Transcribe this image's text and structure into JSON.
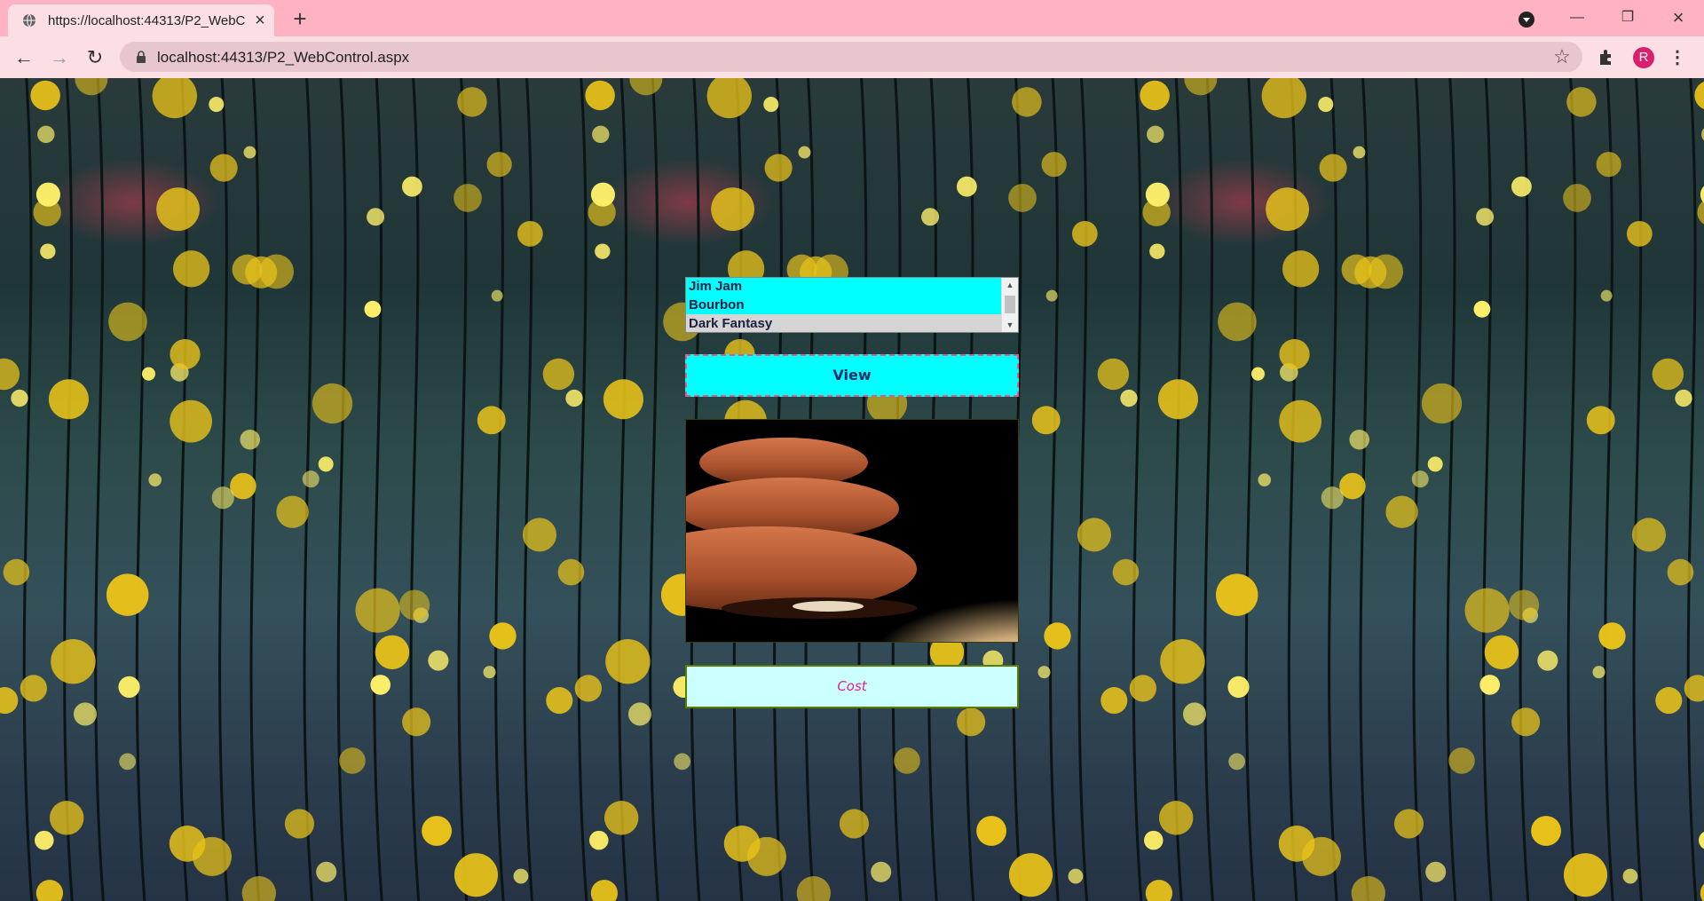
{
  "browser": {
    "tab_title": "https://localhost:44313/P2_WebC",
    "url": "localhost:44313/P2_WebControl.aspx",
    "profile_initial": "R",
    "accent_color": "#ffb2c1"
  },
  "page": {
    "biscuits": {
      "options": [
        "Jim Jam",
        "Bourbon",
        "Dark Fantasy"
      ],
      "selected": "Dark Fantasy"
    },
    "view_button_label": "View",
    "image_subject": "chocolate-filled cookies",
    "cost_label": "Cost",
    "colors": {
      "control_bg": "#00ffff",
      "cost_bg": "#ccffff",
      "cost_text": "#e0209a",
      "view_border": "#e05a8a"
    }
  }
}
